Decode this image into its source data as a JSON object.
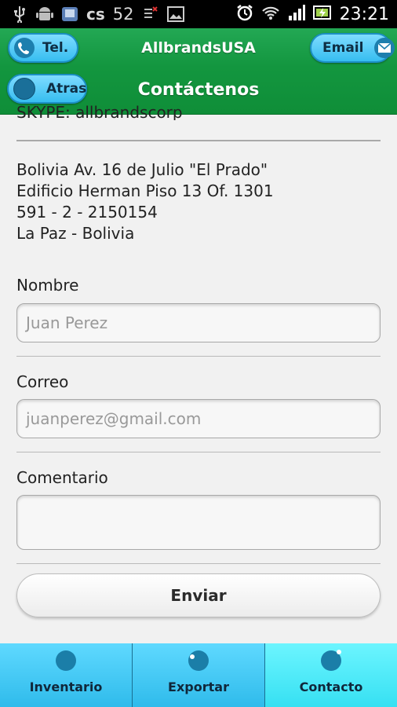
{
  "status_bar": {
    "signal_count": "52",
    "time": "23:21"
  },
  "header": {
    "app_title": "AllbrandsUSA",
    "page_title": "Contáctenos",
    "tel_label": "Tel.",
    "email_label": "Email",
    "back_label": "Atras"
  },
  "contact": {
    "partial_line": "SKYPE: allbrandscorp",
    "address": [
      "Bolivia Av. 16 de Julio \"El Prado\"",
      "Edificio Herman Piso 13 Of. 1301",
      "591 - 2 - 2150154",
      "La Paz - Bolivia"
    ]
  },
  "form": {
    "name_label": "Nombre",
    "name_placeholder": "Juan Perez",
    "email_label": "Correo",
    "email_placeholder": "juanperez@gmail.com",
    "comment_label": "Comentario",
    "comment_value": "",
    "submit_label": "Enviar"
  },
  "footer": {
    "tabs": [
      {
        "label": "Inventario",
        "active": false
      },
      {
        "label": "Exportar",
        "active": false
      },
      {
        "label": "Contacto",
        "active": true
      }
    ]
  },
  "colors": {
    "header_green": "#13963f",
    "button_blue": "#36bdf0",
    "tab_active": "#36e0f2"
  },
  "icons": [
    "usb-icon",
    "android-icon",
    "app-icon",
    "cs-icon",
    "debug-icon",
    "image-icon",
    "alarm-icon",
    "wifi-icon",
    "signal-icon",
    "battery-icon",
    "phone-icon",
    "mail-icon"
  ]
}
